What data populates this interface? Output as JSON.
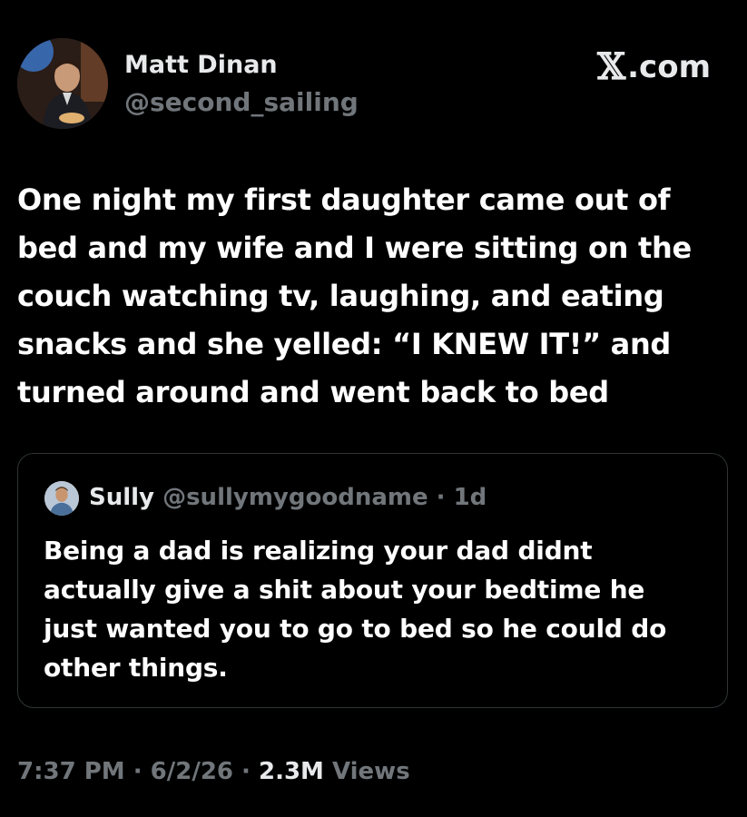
{
  "author": {
    "name": "Matt Dinan",
    "handle": "@second_sailing",
    "avatar_icon": "profile-photo"
  },
  "brand": {
    "glyph": "𝕏",
    "label": ".com"
  },
  "tweet": {
    "text": "One night my first daughter came out of bed and my wife and I were sitting on the couch watching tv, laughing, and eating snacks and she yelled: “I KNEW IT!” and turned around and went back to bed"
  },
  "quote": {
    "name": "Sully",
    "handle": "@sullymygoodname",
    "separator": " · ",
    "age": "1d",
    "text": "Being a dad is realizing your dad didnt actually give a shit about your bedtime he just wanted you to go to bed so he could do other things."
  },
  "footer": {
    "time": "7:37 PM",
    "sep1": " · ",
    "date": "6/2/26",
    "sep2": " · ",
    "views_count": "2.3M",
    "views_label": " Views"
  },
  "colors": {
    "background": "#000000",
    "primary_text": "#e7e9ea",
    "secondary_text": "#71767b",
    "border": "#2f3336"
  }
}
